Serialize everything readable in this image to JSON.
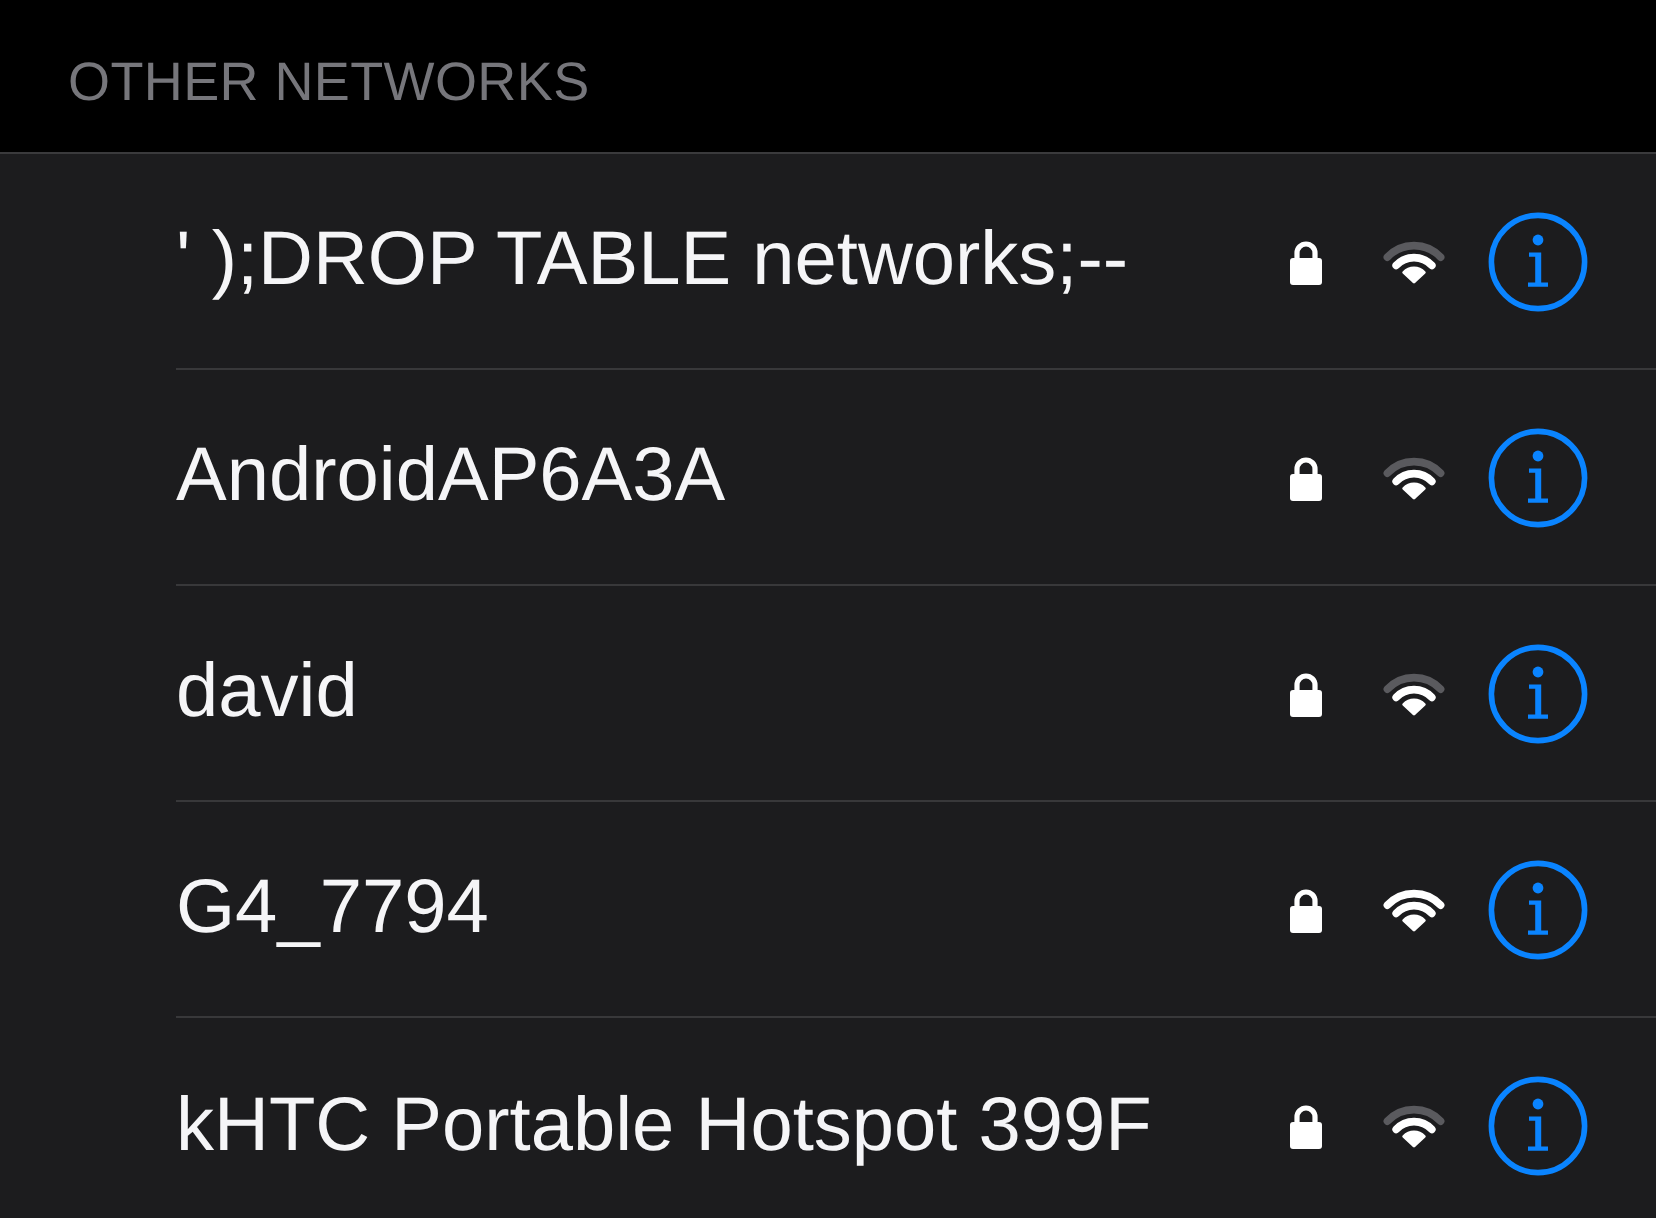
{
  "section_header": "OTHER NETWORKS",
  "networks": [
    {
      "name": "' );DROP TABLE networks;--",
      "locked": true,
      "strong_signal": false
    },
    {
      "name": "AndroidAP6A3A",
      "locked": true,
      "strong_signal": false
    },
    {
      "name": "david",
      "locked": true,
      "strong_signal": false
    },
    {
      "name": "G4_7794",
      "locked": true,
      "strong_signal": true
    },
    {
      "name": "kHTC Portable Hotspot 399F",
      "locked": true,
      "strong_signal": false
    }
  ]
}
